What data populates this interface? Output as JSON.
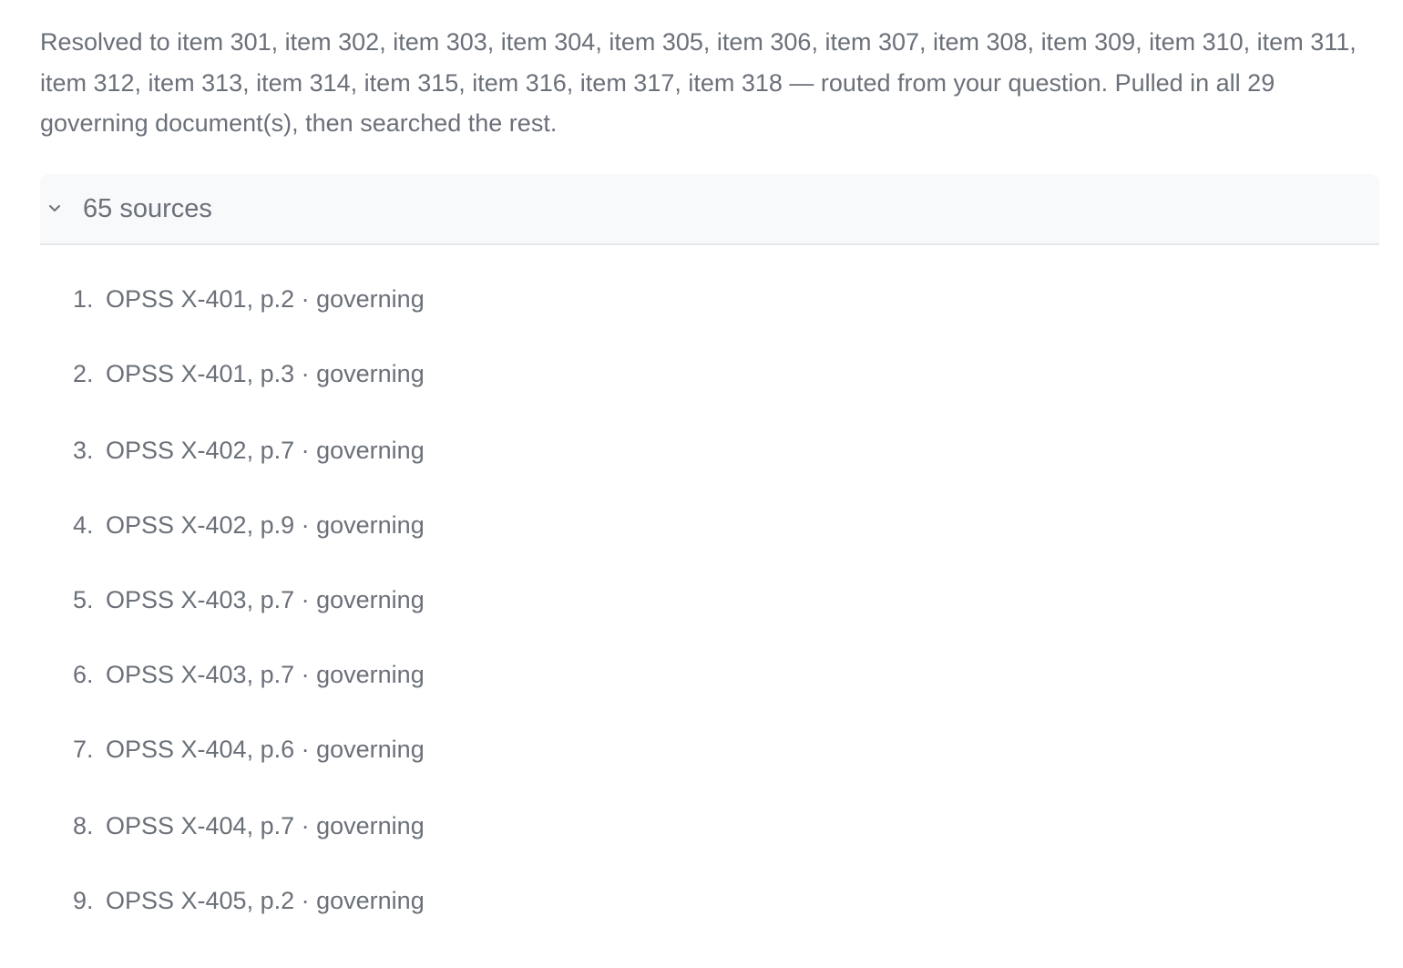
{
  "summary": "Resolved to item 301, item 302, item 303, item 304, item 305, item 306, item 307, item 308, item 309, item 310, item 311, item 312, item 313, item 314, item 315, item 316, item 317, item 318 — routed from your question. Pulled in all 29 governing document(s), then searched the rest.",
  "sources": {
    "label": "65 sources",
    "expanded": true,
    "icon": "chevron-down-icon",
    "separator": " · ",
    "items": [
      {
        "num": "1.",
        "ref": "OPSS X-401, p.2",
        "kind": "governing"
      },
      {
        "num": "2.",
        "ref": "OPSS X-401, p.3",
        "kind": "governing"
      },
      {
        "num": "3.",
        "ref": "OPSS X-402, p.7",
        "kind": "governing"
      },
      {
        "num": "4.",
        "ref": "OPSS X-402, p.9",
        "kind": "governing"
      },
      {
        "num": "5.",
        "ref": "OPSS X-403, p.7",
        "kind": "governing"
      },
      {
        "num": "6.",
        "ref": "OPSS X-403, p.7",
        "kind": "governing"
      },
      {
        "num": "7.",
        "ref": "OPSS X-404, p.6",
        "kind": "governing"
      },
      {
        "num": "8.",
        "ref": "OPSS X-404, p.7",
        "kind": "governing"
      },
      {
        "num": "9.",
        "ref": "OPSS X-405, p.2",
        "kind": "governing"
      }
    ]
  },
  "colors": {
    "text": "#6b7079",
    "header_bg": "#f8f9fb",
    "divider": "#e4e6ea"
  }
}
